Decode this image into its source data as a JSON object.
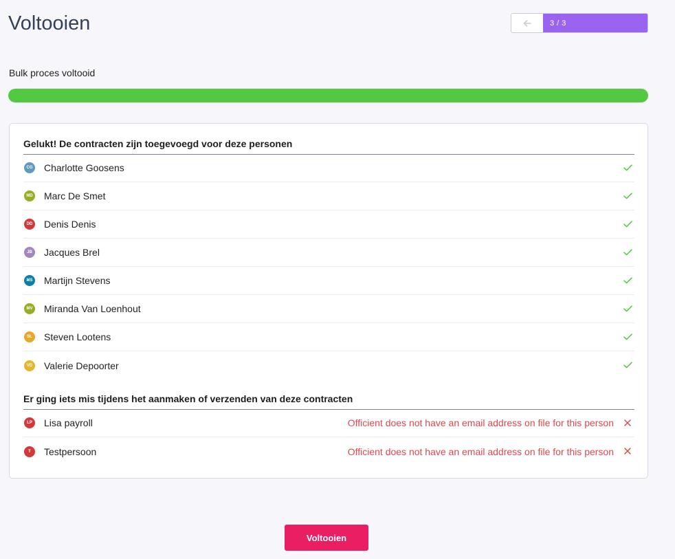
{
  "page_title": "Voltooien",
  "stepper": {
    "step": "3 / 3"
  },
  "progress": {
    "label": "Bulk proces voltooid",
    "percent": 100,
    "color": "#52c940"
  },
  "success_section": {
    "heading": "Gelukt! De contracten zijn toegevoegd voor deze personen",
    "people": [
      {
        "initials": "CG",
        "name": "Charlotte Goosens",
        "color": "#5e9ac2"
      },
      {
        "initials": "MD",
        "name": "Marc De Smet",
        "color": "#97ad25"
      },
      {
        "initials": "DD",
        "name": "Denis Denis",
        "color": "#d2393b"
      },
      {
        "initials": "JB",
        "name": "Jacques Brel",
        "color": "#a286bd"
      },
      {
        "initials": "MS",
        "name": "Martijn Stevens",
        "color": "#0b7fa6"
      },
      {
        "initials": "MV",
        "name": "Miranda Van Loenhout",
        "color": "#97ad25"
      },
      {
        "initials": "SL",
        "name": "Steven Lootens",
        "color": "#eaa62b"
      },
      {
        "initials": "VD",
        "name": "Valerie Depoorter",
        "color": "#e3b62c"
      }
    ],
    "status_icon": "check-icon",
    "status_color": "#52c940"
  },
  "error_section": {
    "heading": "Er ging iets mis tijdens het aanmaken of verzenden van deze contracten",
    "people": [
      {
        "initials": "LP",
        "name": "Lisa payroll",
        "color": "#d2393b",
        "error": "Officient does not have an email address on file for this person"
      },
      {
        "initials": "T",
        "name": "Testpersoon",
        "color": "#d2393b",
        "error": "Officient does not have an email address on file for this person"
      }
    ],
    "status_icon": "cross-icon",
    "status_color": "#e0474d"
  },
  "finish_button": {
    "label": "Voltooien",
    "color": "#ea1e63"
  }
}
